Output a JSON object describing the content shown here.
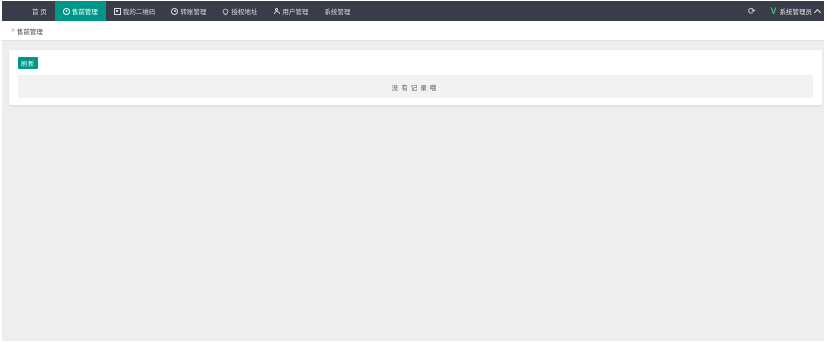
{
  "nav": {
    "items": [
      {
        "label": "首 页",
        "icon": "",
        "active": false
      },
      {
        "label": "售前管理",
        "icon": "clock-icon",
        "active": true
      },
      {
        "label": "我的二维码",
        "icon": "qrcode-icon",
        "active": false
      },
      {
        "label": "转账管理",
        "icon": "target-icon",
        "active": false
      },
      {
        "label": "授权地址",
        "icon": "location-pin-icon",
        "active": false
      },
      {
        "label": "用户管理",
        "icon": "user-icon",
        "active": false
      },
      {
        "label": "系统管理",
        "icon": "",
        "active": false
      }
    ]
  },
  "header": {
    "refresh_symbol": "C",
    "user_name": "系统管理员",
    "logo_letter": "V"
  },
  "breadcrumb": {
    "separator": "»",
    "current": "售前管理"
  },
  "toolbar": {
    "refresh_label": "刷新"
  },
  "table": {
    "empty_text": "没有记录哦"
  },
  "colors": {
    "topbar": "#393d49",
    "accent": "#009688",
    "logo": "#42b983",
    "background": "#eeeeee"
  }
}
